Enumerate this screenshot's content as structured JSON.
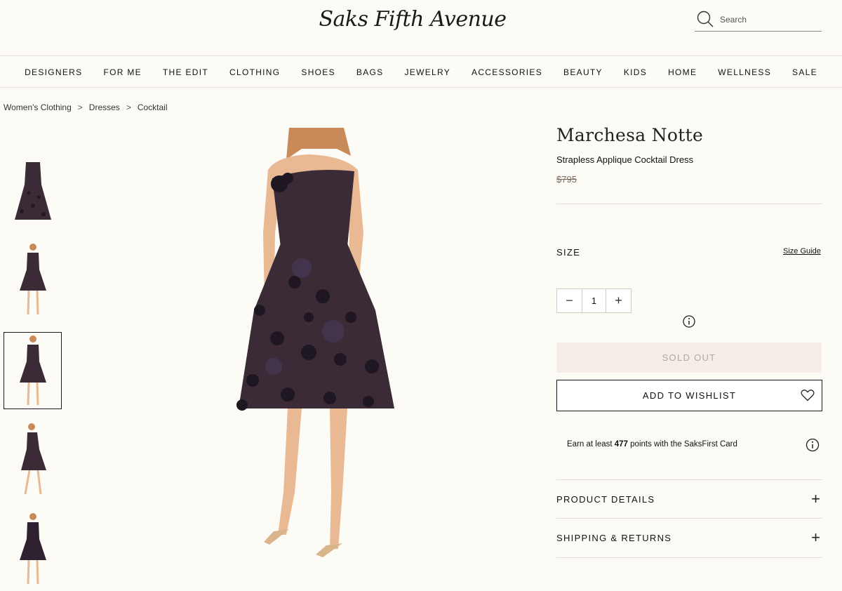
{
  "header": {
    "logo": "Saks Fifth Avenue",
    "search_placeholder": "Search"
  },
  "nav": {
    "items": [
      "DESIGNERS",
      "FOR ME",
      "THE EDIT",
      "CLOTHING",
      "SHOES",
      "BAGS",
      "JEWELRY",
      "ACCESSORIES",
      "BEAUTY",
      "KIDS",
      "HOME",
      "WELLNESS",
      "SALE"
    ]
  },
  "breadcrumb": {
    "items": [
      "Women's Clothing",
      "Dresses",
      "Cocktail"
    ],
    "separator": ">"
  },
  "gallery": {
    "thumbnail_count": 5,
    "active_index": 2
  },
  "product": {
    "brand": "Marchesa Notte",
    "name": "Strapless Applique Cocktail Dress",
    "original_price": "$795"
  },
  "size": {
    "label": "SIZE",
    "guide_link": "Size Guide"
  },
  "quantity": {
    "minus": "−",
    "value": "1",
    "plus": "+"
  },
  "actions": {
    "sold_out": "SOLD OUT",
    "wishlist": "ADD TO WISHLIST"
  },
  "points": {
    "prefix": "Earn at least ",
    "amount": "477",
    "suffix": " points with the SaksFirst Card"
  },
  "accordion": {
    "product_details": "PRODUCT DETAILS",
    "shipping_returns": "SHIPPING & RETURNS",
    "expand_symbol": "+"
  },
  "colors": {
    "background": "#fdfbf6",
    "sold_out_bg": "#f6ede6",
    "sold_out_text": "#b3a89e",
    "dress": "#3a2b36",
    "skin": "#e8b993"
  },
  "icons": {
    "search": "search-icon",
    "info": "info-icon",
    "heart": "heart-icon",
    "plus": "plus-icon"
  }
}
